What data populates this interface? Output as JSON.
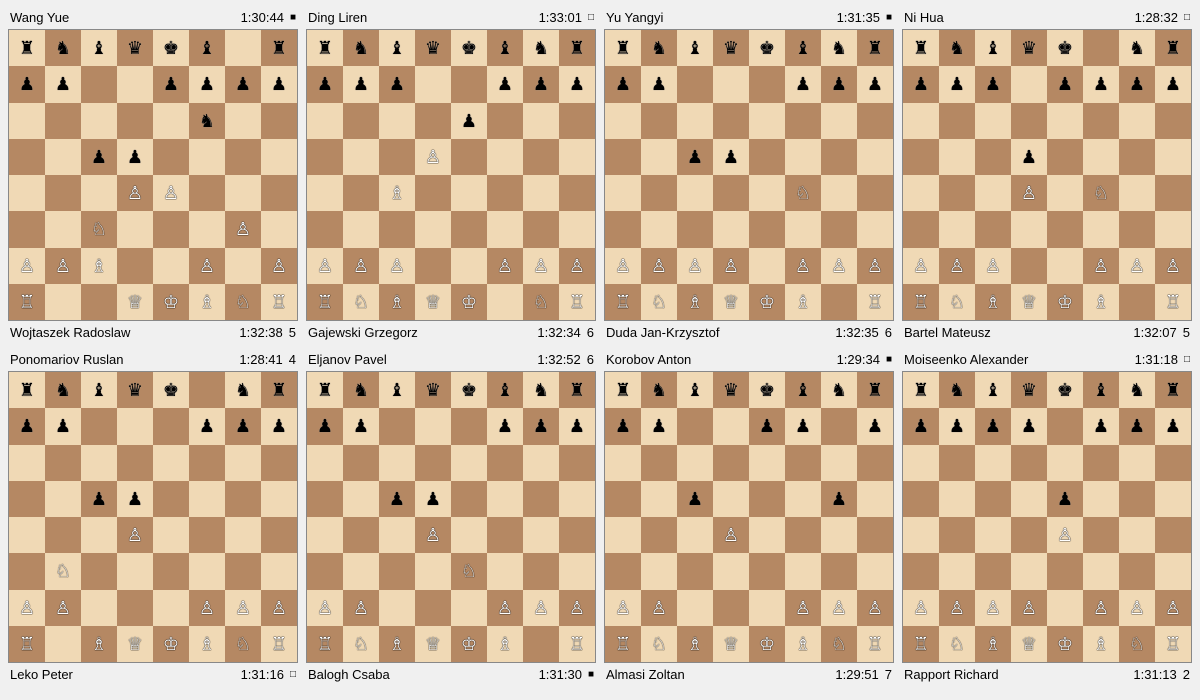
{
  "games": [
    {
      "id": "game1",
      "white_name": "Wang Yue",
      "white_time": "1:30:44",
      "white_indicator": "■",
      "black_name": "Wojtaszek Radoslaw",
      "black_time": "1:32:38",
      "black_moves": "5",
      "board": [
        [
          "br",
          "bn",
          "bb",
          "bq",
          "bk",
          "bb",
          "",
          "br"
        ],
        [
          "bp",
          "bp",
          "",
          "",
          "bp",
          "bp",
          "bp",
          "bp"
        ],
        [
          "",
          "",
          "",
          "",
          "",
          "bn",
          "",
          ""
        ],
        [
          "",
          "",
          "bp",
          "bp",
          "",
          "",
          "",
          ""
        ],
        [
          "",
          "",
          "",
          "wp",
          "wp",
          "",
          "",
          ""
        ],
        [
          "",
          "",
          "wn",
          "",
          "",
          "",
          "wp",
          ""
        ],
        [
          "wp",
          "wp",
          "wb",
          "",
          "",
          "wp",
          "",
          "wp"
        ],
        [
          "wr",
          "",
          "",
          "wq",
          "wk",
          "wb",
          "wn",
          "wr"
        ]
      ]
    },
    {
      "id": "game2",
      "white_name": "Ding Liren",
      "white_time": "1:33:01",
      "white_indicator": "□",
      "black_name": "Gajewski Grzegorz",
      "black_time": "1:32:34",
      "black_moves": "6",
      "board": [
        [
          "br",
          "bn",
          "bb",
          "bq",
          "bk",
          "bb",
          "bn",
          "br"
        ],
        [
          "bp",
          "bp",
          "bp",
          "",
          "",
          "bp",
          "bp",
          "bp"
        ],
        [
          "",
          "",
          "",
          "",
          "bp",
          "",
          "",
          ""
        ],
        [
          "",
          "",
          "",
          "wp",
          "",
          "",
          "",
          ""
        ],
        [
          "",
          "",
          "wb",
          "",
          "",
          "",
          "",
          ""
        ],
        [
          "",
          "",
          "",
          "",
          "",
          "",
          "",
          ""
        ],
        [
          "wp",
          "wp",
          "wp",
          "",
          "",
          "wp",
          "wp",
          "wp"
        ],
        [
          "wr",
          "wn",
          "wb",
          "wq",
          "wk",
          "",
          "wn",
          "wr"
        ]
      ]
    },
    {
      "id": "game3",
      "white_name": "Yu Yangyi",
      "white_time": "1:31:35",
      "white_indicator": "■",
      "black_name": "Duda Jan-Krzysztof",
      "black_time": "1:32:35",
      "black_moves": "6",
      "board": [
        [
          "br",
          "bn",
          "bb",
          "bq",
          "bk",
          "bb",
          "bn",
          "br"
        ],
        [
          "bp",
          "bp",
          "",
          "",
          "",
          "bp",
          "bp",
          "bp"
        ],
        [
          "",
          "",
          "",
          "",
          "",
          "",
          "",
          ""
        ],
        [
          "",
          "",
          "bp",
          "bp",
          "",
          "",
          "",
          ""
        ],
        [
          "",
          "",
          "",
          "",
          "",
          "wn",
          "",
          ""
        ],
        [
          "",
          "",
          "",
          "",
          "",
          "",
          "",
          ""
        ],
        [
          "wp",
          "wp",
          "wp",
          "wp",
          "",
          "wp",
          "wp",
          "wp"
        ],
        [
          "wr",
          "wn",
          "wb",
          "wq",
          "wk",
          "wb",
          "",
          "wr"
        ]
      ]
    },
    {
      "id": "game4",
      "white_name": "Ni Hua",
      "white_time": "1:28:32",
      "white_indicator": "□",
      "black_name": "Bartel Mateusz",
      "black_time": "1:32:07",
      "black_moves": "5",
      "board": [
        [
          "br",
          "bn",
          "bb",
          "bq",
          "bk",
          "",
          "bn",
          "br"
        ],
        [
          "bp",
          "bp",
          "bp",
          "",
          "bp",
          "bp",
          "bp",
          "bp"
        ],
        [
          "",
          "",
          "",
          "",
          "",
          "",
          "",
          ""
        ],
        [
          "",
          "",
          "",
          "bp",
          "",
          "",
          "",
          ""
        ],
        [
          "",
          "",
          "",
          "wp",
          "",
          "wn",
          "",
          ""
        ],
        [
          "",
          "",
          "",
          "",
          "",
          "",
          "",
          ""
        ],
        [
          "wp",
          "wp",
          "wp",
          "",
          "",
          "wp",
          "wp",
          "wp"
        ],
        [
          "wr",
          "wn",
          "wb",
          "wq",
          "wk",
          "wb",
          "",
          "wr"
        ]
      ]
    },
    {
      "id": "game5",
      "white_name": "Ponomariov Ruslan",
      "white_time": "1:28:41",
      "white_moves": "4",
      "black_name": "Leko Peter",
      "black_time": "1:31:16",
      "black_indicator": "□",
      "board": [
        [
          "br",
          "bn",
          "bb",
          "bq",
          "bk",
          "",
          "bn",
          "br"
        ],
        [
          "bp",
          "bp",
          "",
          "",
          "",
          "bp",
          "bp",
          "bp"
        ],
        [
          "",
          "",
          "",
          "",
          "",
          "",
          "",
          ""
        ],
        [
          "",
          "",
          "bp",
          "bp",
          "",
          "",
          "",
          ""
        ],
        [
          "",
          "",
          "",
          "wp",
          "",
          "",
          "",
          ""
        ],
        [
          "",
          "wn",
          "",
          "",
          "",
          "",
          "",
          ""
        ],
        [
          "wp",
          "wp",
          "",
          "",
          "",
          "wp",
          "wp",
          "wp"
        ],
        [
          "wr",
          "",
          "wb",
          "wq",
          "wk",
          "wb",
          "wn",
          "wr"
        ]
      ]
    },
    {
      "id": "game6",
      "white_name": "Eljanov Pavel",
      "white_time": "1:32:52",
      "white_moves": "6",
      "black_name": "Balogh Csaba",
      "black_time": "1:31:30",
      "black_indicator": "■",
      "board": [
        [
          "br",
          "bn",
          "bb",
          "bq",
          "bk",
          "bb",
          "bn",
          "br"
        ],
        [
          "bp",
          "bp",
          "",
          "",
          "",
          "bp",
          "bp",
          "bp"
        ],
        [
          "",
          "",
          "",
          "",
          "",
          "",
          "",
          ""
        ],
        [
          "",
          "",
          "bp",
          "bp",
          "",
          "",
          "",
          ""
        ],
        [
          "",
          "",
          "",
          "wp",
          "",
          "",
          "",
          ""
        ],
        [
          "",
          "",
          "",
          "",
          "wn",
          "",
          "",
          ""
        ],
        [
          "wp",
          "wp",
          "",
          "",
          "",
          "wp",
          "wp",
          "wp"
        ],
        [
          "wr",
          "wn",
          "wb",
          "wq",
          "wk",
          "wb",
          "",
          "wr"
        ]
      ]
    },
    {
      "id": "game7",
      "white_name": "Korobov Anton",
      "white_time": "1:29:34",
      "white_indicator": "■",
      "black_name": "Almasi Zoltan",
      "black_time": "1:29:51",
      "black_moves": "7",
      "board": [
        [
          "br",
          "bn",
          "bb",
          "bq",
          "bk",
          "bb",
          "bn",
          "br"
        ],
        [
          "bp",
          "bp",
          "",
          "",
          "bp",
          "bp",
          "",
          "bp"
        ],
        [
          "",
          "",
          "",
          "",
          "",
          "",
          "",
          ""
        ],
        [
          "",
          "",
          "bp",
          "",
          "",
          "",
          "bp",
          ""
        ],
        [
          "",
          "",
          "",
          "wp",
          "",
          "",
          "",
          ""
        ],
        [
          "",
          "",
          "",
          "",
          "",
          "",
          "",
          ""
        ],
        [
          "wp",
          "wp",
          "",
          "",
          "",
          "wp",
          "wp",
          "wp"
        ],
        [
          "wr",
          "wn",
          "wb",
          "wq",
          "wk",
          "wb",
          "wn",
          "wr"
        ]
      ]
    },
    {
      "id": "game8",
      "white_name": "Moiseenko Alexander",
      "white_time": "1:31:18",
      "white_indicator": "□",
      "black_name": "Rapport Richard",
      "black_time": "1:31:13",
      "black_moves": "2",
      "board": [
        [
          "br",
          "bn",
          "bb",
          "bq",
          "bk",
          "bb",
          "bn",
          "br"
        ],
        [
          "bp",
          "bp",
          "bp",
          "bp",
          "",
          "bp",
          "bp",
          "bp"
        ],
        [
          "",
          "",
          "",
          "",
          "",
          "",
          "",
          ""
        ],
        [
          "",
          "",
          "",
          "",
          "bp",
          "",
          "",
          ""
        ],
        [
          "",
          "",
          "",
          "",
          "wp",
          "",
          "",
          ""
        ],
        [
          "",
          "",
          "",
          "",
          "",
          "",
          "",
          ""
        ],
        [
          "wp",
          "wp",
          "wp",
          "wp",
          "",
          "wp",
          "wp",
          "wp"
        ],
        [
          "wr",
          "wn",
          "wb",
          "wq",
          "wk",
          "wb",
          "wn",
          "wr"
        ]
      ]
    }
  ]
}
